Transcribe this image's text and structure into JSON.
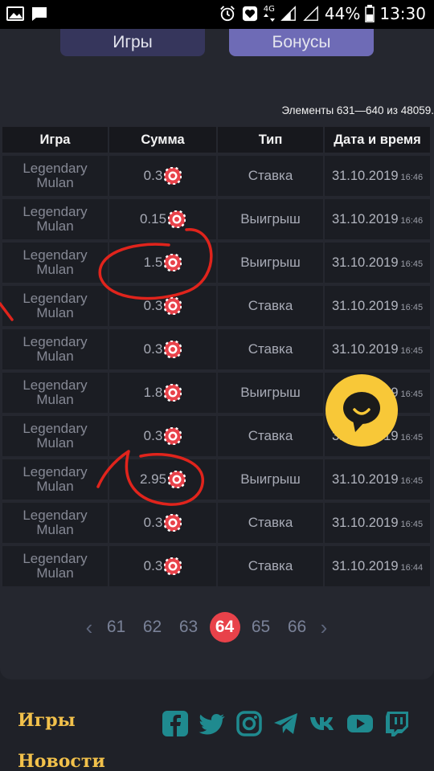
{
  "status_bar": {
    "network": "4G",
    "battery": "44%",
    "time": "13:30"
  },
  "tabs": {
    "games": "Игры",
    "bonuses": "Бонусы"
  },
  "items_count": "Элементы 631—640 из 48059.",
  "table": {
    "headers": [
      "Игра",
      "Сумма",
      "Тип",
      "Дата и время"
    ],
    "rows": [
      {
        "game": "Legendary Mulan",
        "amount": "0.3",
        "type": "Ставка",
        "date": "31.10.2019",
        "time": "16:46"
      },
      {
        "game": "Legendary Mulan",
        "amount": "0.15",
        "type": "Выигрыш",
        "date": "31.10.2019",
        "time": "16:46"
      },
      {
        "game": "Legendary Mulan",
        "amount": "1.5",
        "type": "Выигрыш",
        "date": "31.10.2019",
        "time": "16:45"
      },
      {
        "game": "Legendary Mulan",
        "amount": "0.3",
        "type": "Ставка",
        "date": "31.10.2019",
        "time": "16:45"
      },
      {
        "game": "Legendary Mulan",
        "amount": "0.3",
        "type": "Ставка",
        "date": "31.10.2019",
        "time": "16:45"
      },
      {
        "game": "Legendary Mulan",
        "amount": "1.8",
        "type": "Выигрыш",
        "date": "31.10.2019",
        "time": "16:45"
      },
      {
        "game": "Legendary Mulan",
        "amount": "0.3",
        "type": "Ставка",
        "date": "31.10.2019",
        "time": "16:45"
      },
      {
        "game": "Legendary Mulan",
        "amount": "2.95",
        "type": "Выигрыш",
        "date": "31.10.2019",
        "time": "16:45"
      },
      {
        "game": "Legendary Mulan",
        "amount": "0.3",
        "type": "Ставка",
        "date": "31.10.2019",
        "time": "16:45"
      },
      {
        "game": "Legendary Mulan",
        "amount": "0.3",
        "type": "Ставка",
        "date": "31.10.2019",
        "time": "16:44"
      }
    ]
  },
  "pagination": {
    "prev": "‹",
    "pages": [
      "61",
      "62",
      "63",
      "64",
      "65",
      "66"
    ],
    "active": "64",
    "next": "›"
  },
  "footer": {
    "links": [
      "Игры",
      "Новости"
    ],
    "socials": [
      "facebook-icon",
      "twitter-icon",
      "instagram-icon",
      "telegram-icon",
      "vk-icon",
      "youtube-icon",
      "twitch-icon"
    ]
  },
  "colors": {
    "accent_gold": "#f2c14b",
    "social_teal": "#1f8a8f",
    "active_page": "#e8424a",
    "chat_yellow": "#f8c838",
    "annotation_red": "#e0241c"
  }
}
